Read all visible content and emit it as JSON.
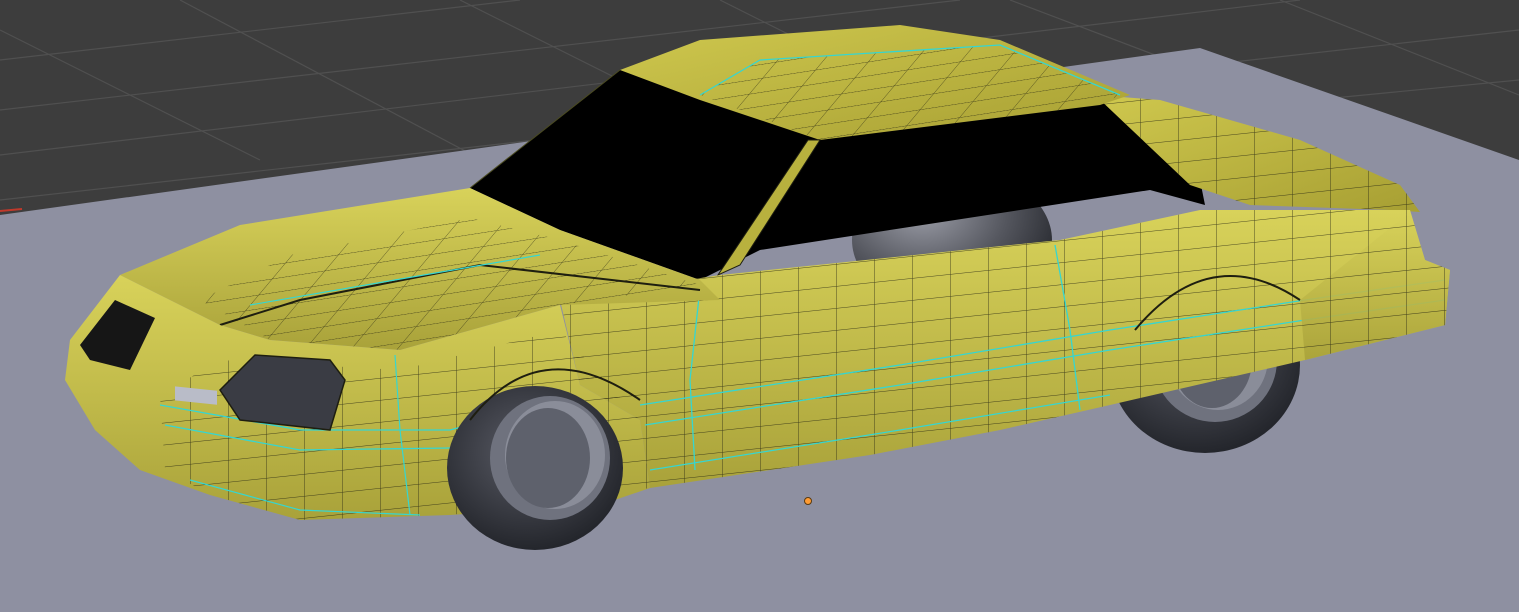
{
  "viewport": {
    "background_color": "#3d3d3d",
    "grid_line_color": "#505050",
    "ground_plane_color": "#8e90a1",
    "object_body_color": "#c9c24a",
    "object_body_shadow_color": "#8f8a2c",
    "wire_edge_color": "#1e1e10",
    "seam_edge_color": "#36d6d0",
    "wheel_tire_color": "#3b3d45",
    "wheel_rim_color": "#8a8d99",
    "glass_color": "#000000",
    "origin_marker_color": "#ff9c33"
  },
  "scene": {
    "object_icon": "car-mesh-icon",
    "grid_icon": "grid-floor-icon",
    "origin_icon": "object-origin-icon",
    "axis_icon": "x-axis-red-icon"
  }
}
